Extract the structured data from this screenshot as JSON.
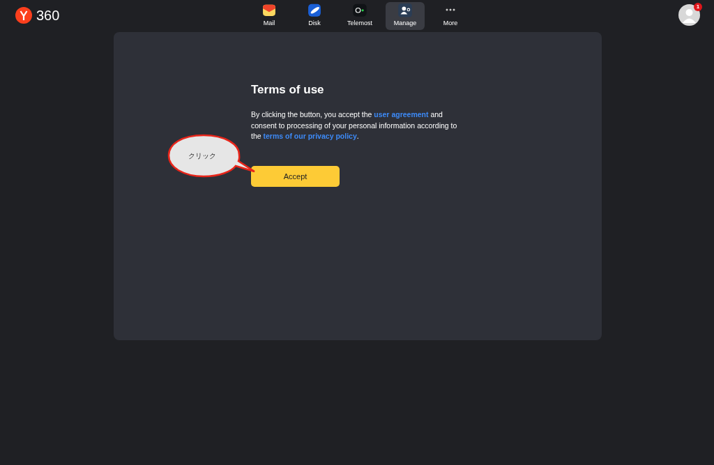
{
  "logo": {
    "text": "360"
  },
  "nav": [
    {
      "label": "Mail",
      "kind": "mail",
      "selected": false
    },
    {
      "label": "Disk",
      "kind": "disk",
      "selected": false
    },
    {
      "label": "Telemost",
      "kind": "telemost",
      "selected": false
    },
    {
      "label": "Manage",
      "kind": "manage",
      "selected": true
    },
    {
      "label": "More",
      "kind": "more",
      "selected": false
    }
  ],
  "avatar": {
    "badge": "1"
  },
  "terms": {
    "title": "Terms of use",
    "body": [
      {
        "kind": "text",
        "text": "By clicking the button, you accept the "
      },
      {
        "kind": "link",
        "text": "user agreement"
      },
      {
        "kind": "text",
        "text": " and consent to processing of your personal information according to the "
      },
      {
        "kind": "link",
        "text": "terms of our privacy policy"
      },
      {
        "kind": "text",
        "text": "."
      }
    ],
    "button": "Accept"
  },
  "callout": {
    "text": "クリック"
  }
}
